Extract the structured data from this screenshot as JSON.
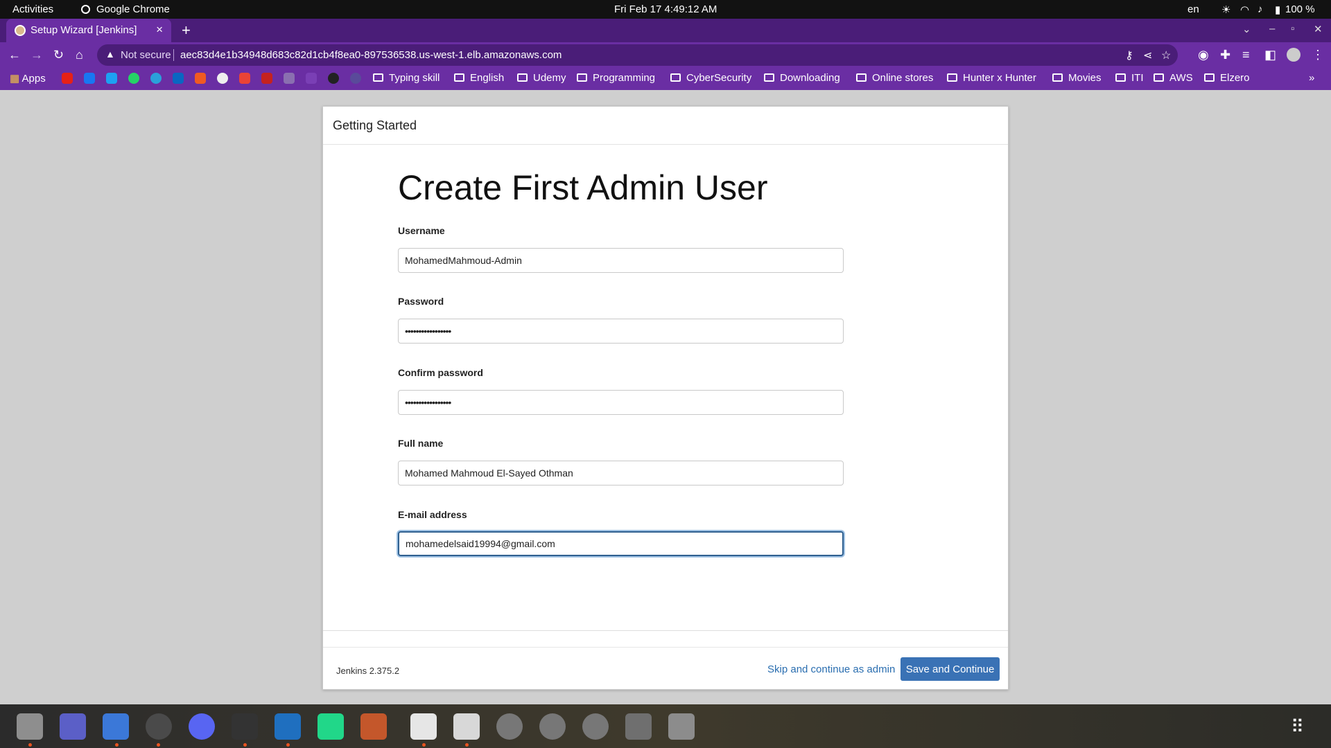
{
  "system_bar": {
    "activities": "Activities",
    "app_name": "Google Chrome",
    "clock": "Fri Feb 17  4:49:12 AM",
    "lang": "en",
    "battery": "100 %"
  },
  "browser": {
    "tab_title": "Setup Wizard [Jenkins]",
    "tab_close": "×",
    "new_tab": "+",
    "security_label": "Not secure",
    "url": "aec83d4e1b34948d683c82d1cb4f8ea0-897536538.us-west-1.elb.amazonaws.com",
    "bookmarks": [
      "Typing skill",
      "English",
      "Udemy",
      "Programming",
      "CyberSecurity",
      "Downloading",
      "Online stores",
      "Hunter x Hunter",
      "Movies",
      "ITI",
      "AWS",
      "Elzero"
    ],
    "apps_label": "Apps",
    "more_bookmarks": "»"
  },
  "wizard": {
    "header": "Getting Started",
    "title": "Create First Admin User",
    "fields": {
      "username": {
        "label": "Username",
        "value": "MohamedMahmoud-Admin"
      },
      "password": {
        "label": "Password",
        "value": "•••••••••••••••••"
      },
      "confirm_password": {
        "label": "Confirm password",
        "value": "•••••••••••••••••"
      },
      "full_name": {
        "label": "Full name",
        "value": "Mohamed Mahmoud El-Sayed Othman"
      },
      "email": {
        "label": "E-mail address",
        "value": "mohamedelsaid19994@gmail.com"
      }
    },
    "version": "Jenkins 2.375.2",
    "skip_label": "Skip and continue as admin",
    "save_label": "Save and Continue"
  },
  "colors": {
    "browser_frame": "#6a2ea3",
    "primary_button": "#3a72b5",
    "link": "#2a6eb0"
  }
}
